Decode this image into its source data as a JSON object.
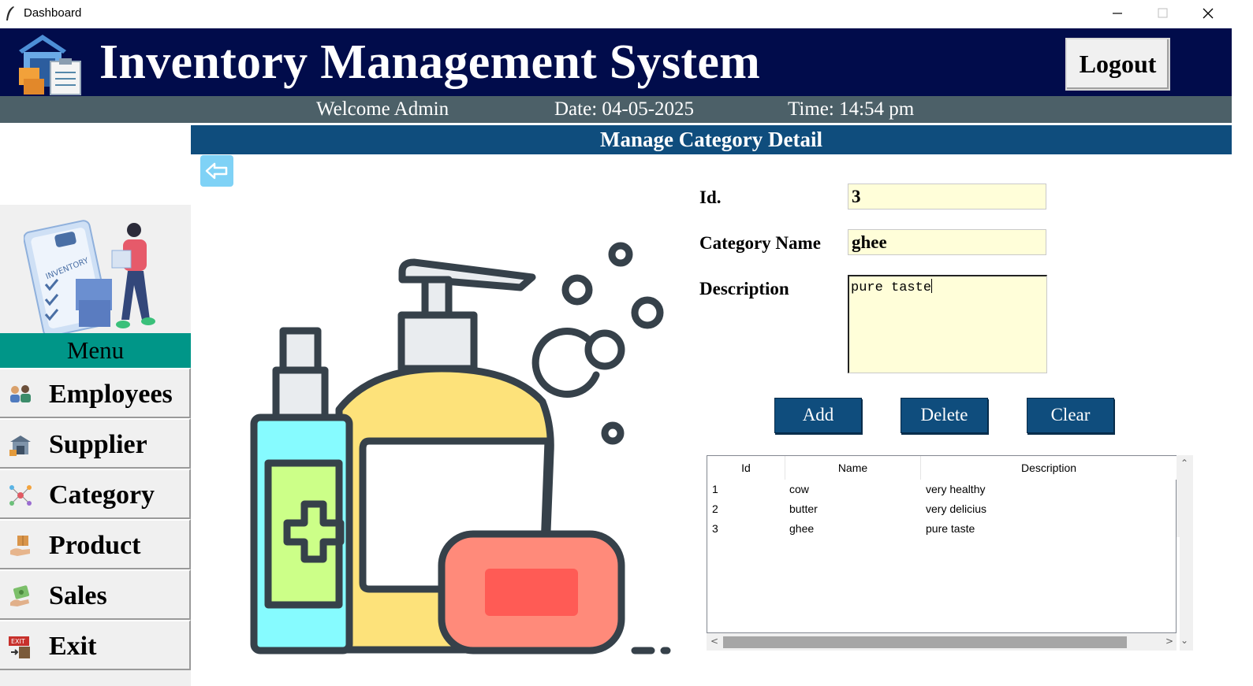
{
  "window": {
    "title": "Dashboard"
  },
  "header": {
    "title": "Inventory Management System",
    "logout_label": "Logout"
  },
  "subheader": {
    "welcome": "Welcome Admin",
    "date": "Date: 04-05-2025",
    "time": "Time: 14:54 pm"
  },
  "sidebar": {
    "menu_label": "Menu",
    "items": [
      {
        "label": "Employees",
        "icon": "employees-icon"
      },
      {
        "label": "Supplier",
        "icon": "supplier-icon"
      },
      {
        "label": "Category",
        "icon": "category-icon"
      },
      {
        "label": "Product",
        "icon": "product-icon"
      },
      {
        "label": "Sales",
        "icon": "sales-icon"
      },
      {
        "label": "Exit",
        "icon": "exit-icon"
      }
    ]
  },
  "section": {
    "title": "Manage Category Detail"
  },
  "form": {
    "id_label": "Id.",
    "id_value": "3",
    "name_label": "Category Name",
    "name_value": "ghee",
    "desc_label": "Description",
    "desc_value": "pure taste"
  },
  "buttons": {
    "add": "Add",
    "delete": "Delete",
    "clear": "Clear"
  },
  "table": {
    "columns": [
      "Id",
      "Name",
      "Description"
    ],
    "rows": [
      {
        "id": "1",
        "name": "cow",
        "description": "very healthy"
      },
      {
        "id": "2",
        "name": "butter",
        "description": "very delicius"
      },
      {
        "id": "3",
        "name": "ghee",
        "description": "pure taste"
      }
    ]
  },
  "colors": {
    "header_bg": "#010c4b",
    "subheader_bg": "#4c6068",
    "section_bg": "#0f4d7d",
    "menu_bg": "#009688",
    "field_bg": "#fffed9"
  }
}
